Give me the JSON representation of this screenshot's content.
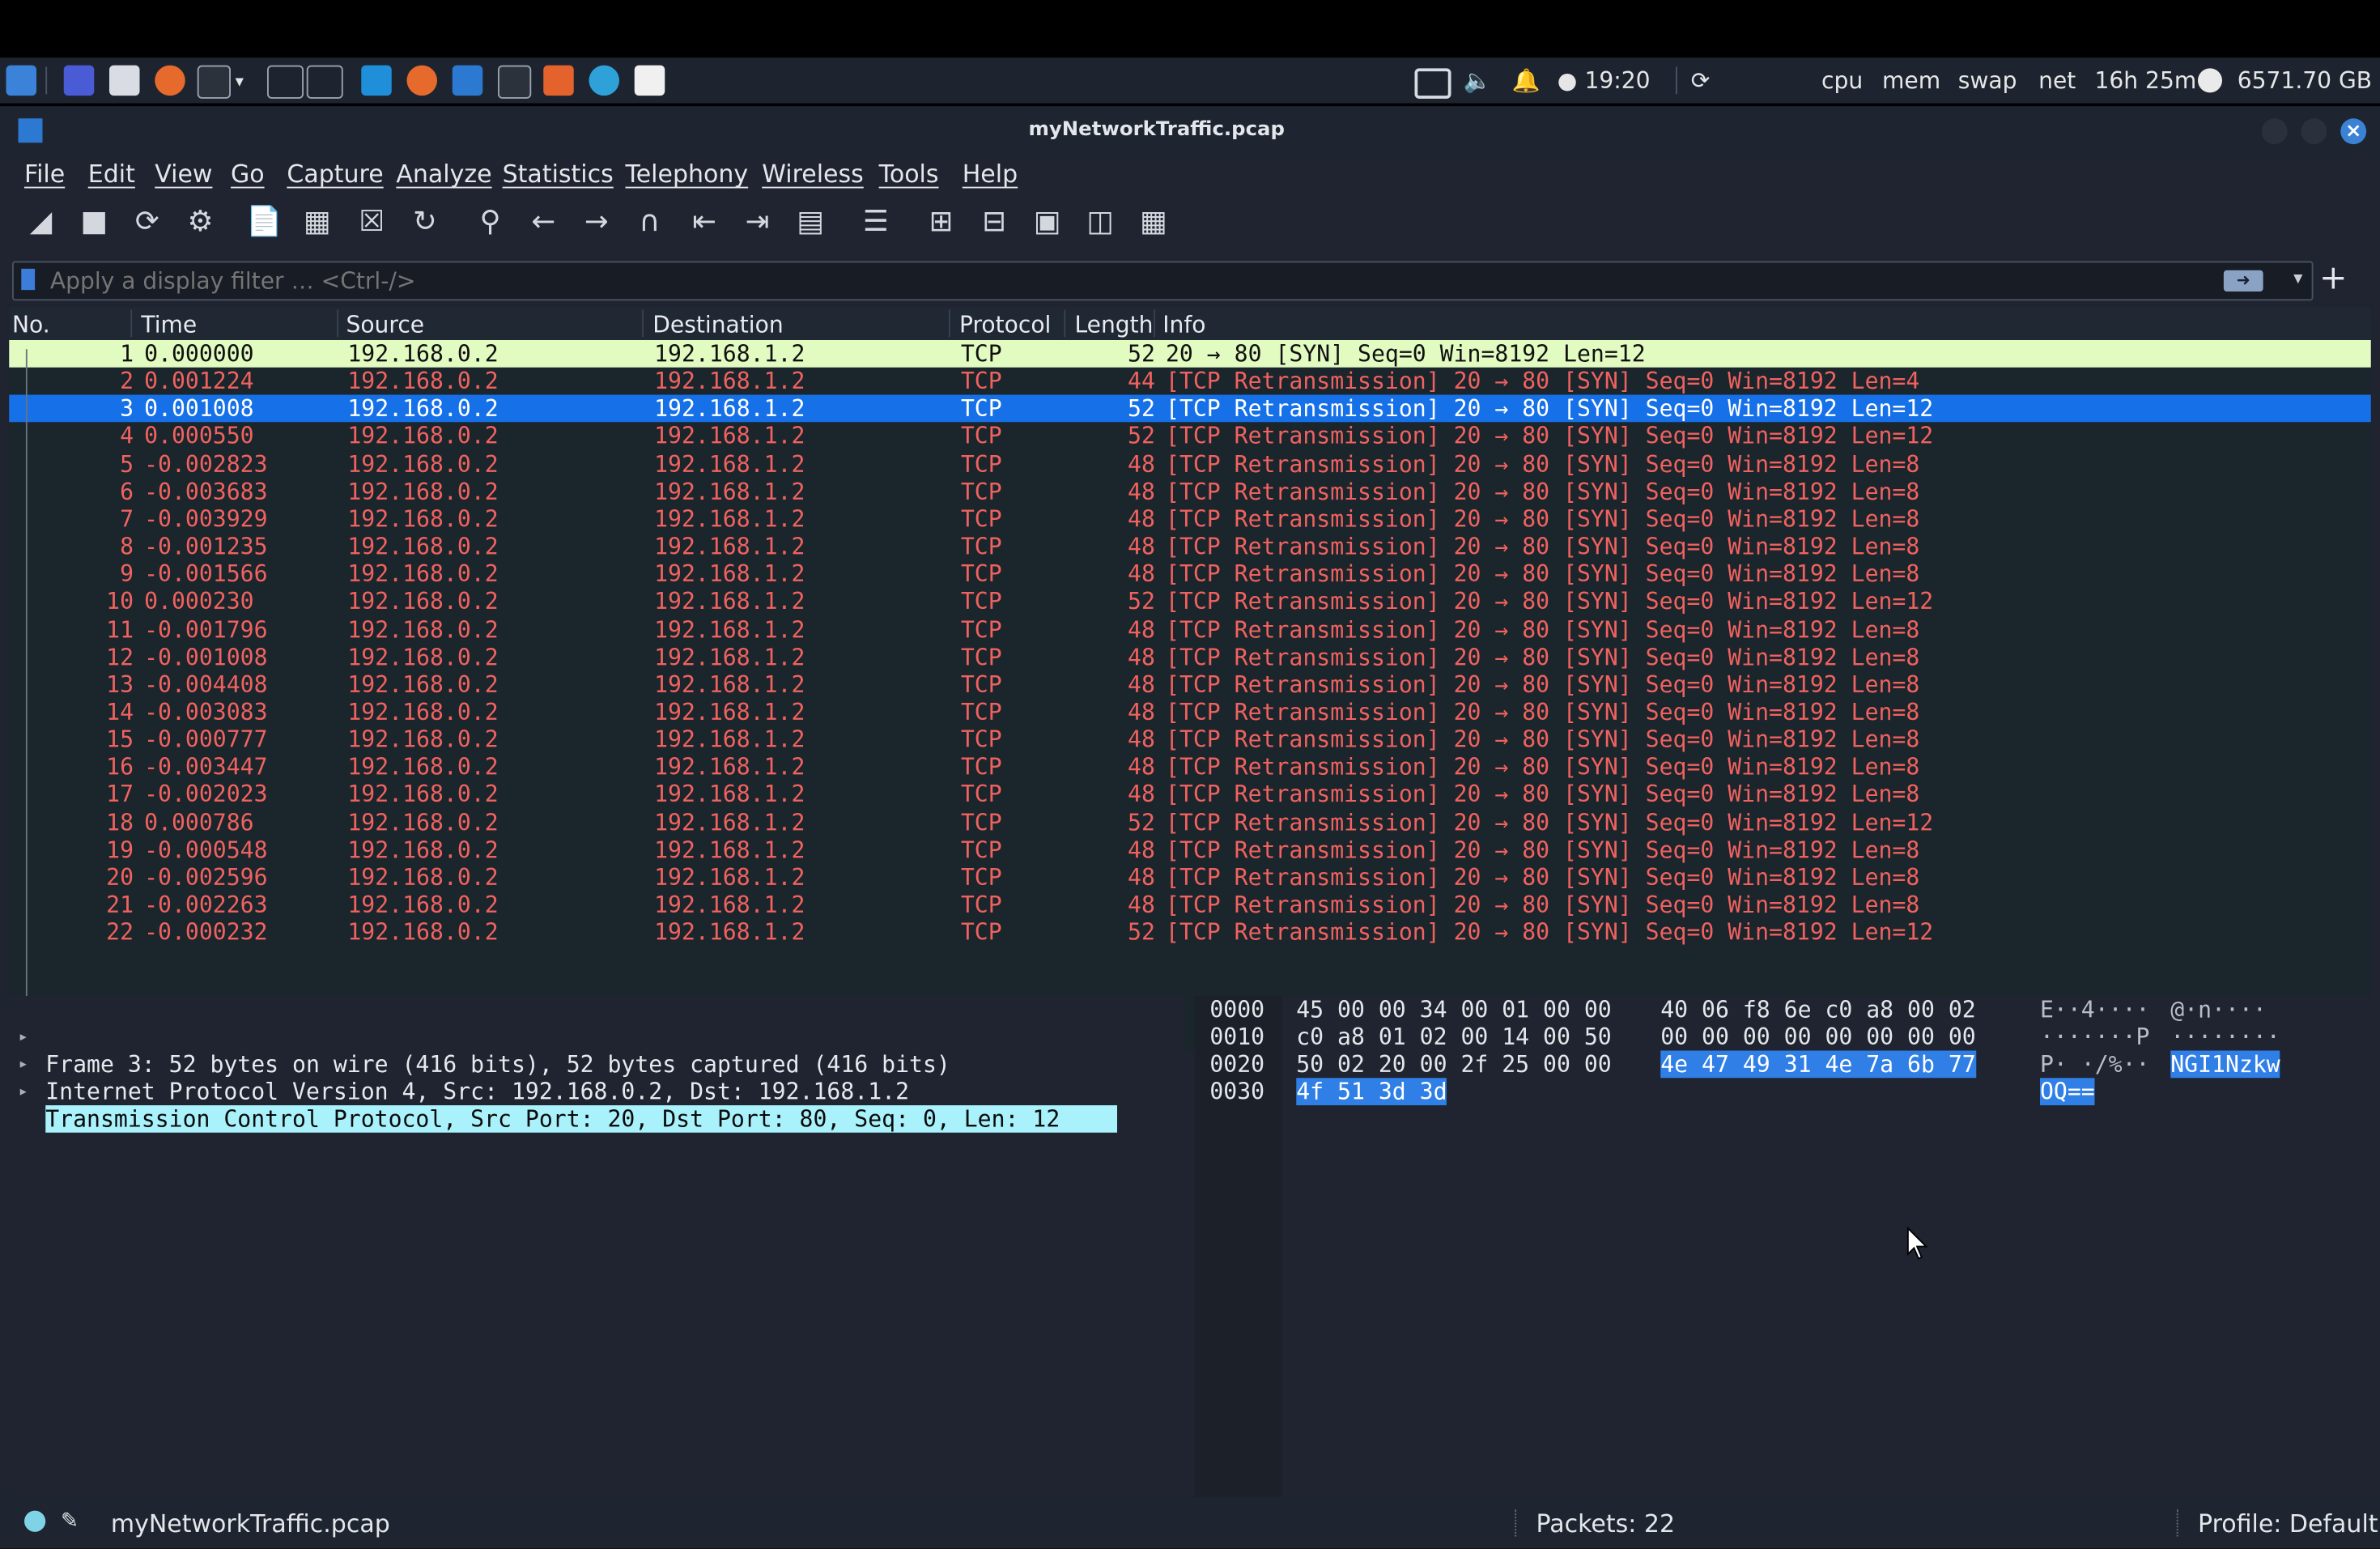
{
  "taskbar": {
    "clock": "19:20",
    "cpu": "cpu",
    "mem": "mem",
    "swap": "swap",
    "net": "net",
    "uptime": "16h 25m",
    "disk": "6571.70 GB"
  },
  "window": {
    "title": "myNetworkTraffic.pcap"
  },
  "menu": [
    "File",
    "Edit",
    "View",
    "Go",
    "Capture",
    "Analyze",
    "Statistics",
    "Telephony",
    "Wireless",
    "Tools",
    "Help"
  ],
  "filter": {
    "placeholder": "Apply a display filter … <Ctrl-/>",
    "value": ""
  },
  "packet_list": {
    "columns": [
      "No.",
      "Time",
      "Source",
      "Destination",
      "Protocol",
      "Length",
      "Info"
    ],
    "rows": [
      {
        "no": "1",
        "time": "0.000000",
        "src": "192.168.0.2",
        "dst": "192.168.1.2",
        "proto": "TCP",
        "len": "52",
        "info": "20 → 80 [SYN] Seq=0 Win=8192 Len=12"
      },
      {
        "no": "2",
        "time": "0.001224",
        "src": "192.168.0.2",
        "dst": "192.168.1.2",
        "proto": "TCP",
        "len": "44",
        "info": "[TCP Retransmission] 20 → 80 [SYN] Seq=0 Win=8192 Len=4"
      },
      {
        "no": "3",
        "time": "0.001008",
        "src": "192.168.0.2",
        "dst": "192.168.1.2",
        "proto": "TCP",
        "len": "52",
        "info": "[TCP Retransmission] 20 → 80 [SYN] Seq=0 Win=8192 Len=12"
      },
      {
        "no": "4",
        "time": "0.000550",
        "src": "192.168.0.2",
        "dst": "192.168.1.2",
        "proto": "TCP",
        "len": "52",
        "info": "[TCP Retransmission] 20 → 80 [SYN] Seq=0 Win=8192 Len=12"
      },
      {
        "no": "5",
        "time": "-0.002823",
        "src": "192.168.0.2",
        "dst": "192.168.1.2",
        "proto": "TCP",
        "len": "48",
        "info": "[TCP Retransmission] 20 → 80 [SYN] Seq=0 Win=8192 Len=8"
      },
      {
        "no": "6",
        "time": "-0.003683",
        "src": "192.168.0.2",
        "dst": "192.168.1.2",
        "proto": "TCP",
        "len": "48",
        "info": "[TCP Retransmission] 20 → 80 [SYN] Seq=0 Win=8192 Len=8"
      },
      {
        "no": "7",
        "time": "-0.003929",
        "src": "192.168.0.2",
        "dst": "192.168.1.2",
        "proto": "TCP",
        "len": "48",
        "info": "[TCP Retransmission] 20 → 80 [SYN] Seq=0 Win=8192 Len=8"
      },
      {
        "no": "8",
        "time": "-0.001235",
        "src": "192.168.0.2",
        "dst": "192.168.1.2",
        "proto": "TCP",
        "len": "48",
        "info": "[TCP Retransmission] 20 → 80 [SYN] Seq=0 Win=8192 Len=8"
      },
      {
        "no": "9",
        "time": "-0.001566",
        "src": "192.168.0.2",
        "dst": "192.168.1.2",
        "proto": "TCP",
        "len": "48",
        "info": "[TCP Retransmission] 20 → 80 [SYN] Seq=0 Win=8192 Len=8"
      },
      {
        "no": "10",
        "time": "0.000230",
        "src": "192.168.0.2",
        "dst": "192.168.1.2",
        "proto": "TCP",
        "len": "52",
        "info": "[TCP Retransmission] 20 → 80 [SYN] Seq=0 Win=8192 Len=12"
      },
      {
        "no": "11",
        "time": "-0.001796",
        "src": "192.168.0.2",
        "dst": "192.168.1.2",
        "proto": "TCP",
        "len": "48",
        "info": "[TCP Retransmission] 20 → 80 [SYN] Seq=0 Win=8192 Len=8"
      },
      {
        "no": "12",
        "time": "-0.001008",
        "src": "192.168.0.2",
        "dst": "192.168.1.2",
        "proto": "TCP",
        "len": "48",
        "info": "[TCP Retransmission] 20 → 80 [SYN] Seq=0 Win=8192 Len=8"
      },
      {
        "no": "13",
        "time": "-0.004408",
        "src": "192.168.0.2",
        "dst": "192.168.1.2",
        "proto": "TCP",
        "len": "48",
        "info": "[TCP Retransmission] 20 → 80 [SYN] Seq=0 Win=8192 Len=8"
      },
      {
        "no": "14",
        "time": "-0.003083",
        "src": "192.168.0.2",
        "dst": "192.168.1.2",
        "proto": "TCP",
        "len": "48",
        "info": "[TCP Retransmission] 20 → 80 [SYN] Seq=0 Win=8192 Len=8"
      },
      {
        "no": "15",
        "time": "-0.000777",
        "src": "192.168.0.2",
        "dst": "192.168.1.2",
        "proto": "TCP",
        "len": "48",
        "info": "[TCP Retransmission] 20 → 80 [SYN] Seq=0 Win=8192 Len=8"
      },
      {
        "no": "16",
        "time": "-0.003447",
        "src": "192.168.0.2",
        "dst": "192.168.1.2",
        "proto": "TCP",
        "len": "48",
        "info": "[TCP Retransmission] 20 → 80 [SYN] Seq=0 Win=8192 Len=8"
      },
      {
        "no": "17",
        "time": "-0.002023",
        "src": "192.168.0.2",
        "dst": "192.168.1.2",
        "proto": "TCP",
        "len": "48",
        "info": "[TCP Retransmission] 20 → 80 [SYN] Seq=0 Win=8192 Len=8"
      },
      {
        "no": "18",
        "time": "0.000786",
        "src": "192.168.0.2",
        "dst": "192.168.1.2",
        "proto": "TCP",
        "len": "52",
        "info": "[TCP Retransmission] 20 → 80 [SYN] Seq=0 Win=8192 Len=12"
      },
      {
        "no": "19",
        "time": "-0.000548",
        "src": "192.168.0.2",
        "dst": "192.168.1.2",
        "proto": "TCP",
        "len": "48",
        "info": "[TCP Retransmission] 20 → 80 [SYN] Seq=0 Win=8192 Len=8"
      },
      {
        "no": "20",
        "time": "-0.002596",
        "src": "192.168.0.2",
        "dst": "192.168.1.2",
        "proto": "TCP",
        "len": "48",
        "info": "[TCP Retransmission] 20 → 80 [SYN] Seq=0 Win=8192 Len=8"
      },
      {
        "no": "21",
        "time": "-0.002263",
        "src": "192.168.0.2",
        "dst": "192.168.1.2",
        "proto": "TCP",
        "len": "48",
        "info": "[TCP Retransmission] 20 → 80 [SYN] Seq=0 Win=8192 Len=8"
      },
      {
        "no": "22",
        "time": "-0.000232",
        "src": "192.168.0.2",
        "dst": "192.168.1.2",
        "proto": "TCP",
        "len": "52",
        "info": "[TCP Retransmission] 20 → 80 [SYN] Seq=0 Win=8192 Len=12"
      }
    ],
    "selected_row": 3
  },
  "details": [
    "Frame 3: 52 bytes on wire (416 bits), 52 bytes captured (416 bits)",
    "Internet Protocol Version 4, Src: 192.168.0.2, Dst: 192.168.1.2",
    "Transmission Control Protocol, Src Port: 20, Dst Port: 80, Seq: 0, Len: 12"
  ],
  "bytes": [
    {
      "offset": "0000",
      "hex1": "45 00 00 34 00 01 00 00",
      "hex2": "40 06 f8 6e c0 a8 00 02",
      "asc1": "E··4····",
      "asc2": "@·n····"
    },
    {
      "offset": "0010",
      "hex1": "c0 a8 01 02 00 14 00 50",
      "hex2": "00 00 00 00 00 00 00 00",
      "asc1": "·······P",
      "asc2": "········"
    },
    {
      "offset": "0020",
      "hex1": "50 02 20 00 2f 25 00 00",
      "hex2": "4e 47 49 31 4e 7a 6b 77",
      "asc1": "P· ·/%··",
      "asc2": "NGI1Nzkw"
    },
    {
      "offset": "0030",
      "hex1": "4f 51 3d 3d",
      "hex2": "",
      "asc1": "OQ==",
      "asc2": ""
    }
  ],
  "status": {
    "file": "myNetworkTraffic.pcap",
    "packets": "Packets: 22",
    "profile": "Profile: Default"
  },
  "colors": {
    "row_first_bg": "#e2fbc1",
    "row_selected_bg": "#1670e8",
    "retrans_text": "#f0625f",
    "detail_highlight": "#a9f2fb",
    "byte_highlight": "#2f7fe6"
  }
}
